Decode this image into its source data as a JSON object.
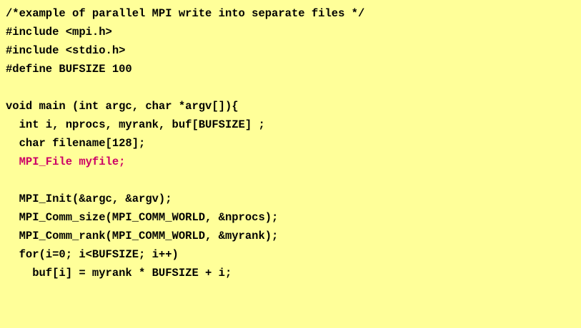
{
  "code": {
    "lines": [
      {
        "text": "/*example of parallel MPI write into separate files */",
        "highlight": false
      },
      {
        "text": "#include <mpi.h>",
        "highlight": false
      },
      {
        "text": "#include <stdio.h>",
        "highlight": false
      },
      {
        "text": "#define BUFSIZE 100",
        "highlight": false
      },
      {
        "text": "",
        "highlight": false
      },
      {
        "text": "void main (int argc, char *argv[]){",
        "highlight": false
      },
      {
        "text": "  int i, nprocs, myrank, buf[BUFSIZE] ;",
        "highlight": false
      },
      {
        "text": "  char filename[128];",
        "highlight": false
      },
      {
        "text": "  MPI_File myfile;",
        "highlight": true
      },
      {
        "text": "",
        "highlight": false
      },
      {
        "text": "  MPI_Init(&argc, &argv);",
        "highlight": false
      },
      {
        "text": "  MPI_Comm_size(MPI_COMM_WORLD, &nprocs);",
        "highlight": false
      },
      {
        "text": "  MPI_Comm_rank(MPI_COMM_WORLD, &myrank);",
        "highlight": false
      },
      {
        "text": "  for(i=0; i<BUFSIZE; i++)",
        "highlight": false
      },
      {
        "text": "    buf[i] = myrank * BUFSIZE + i;",
        "highlight": false
      }
    ]
  },
  "colors": {
    "background": "#ffff99",
    "text": "#000000",
    "highlight": "#cc0066"
  }
}
